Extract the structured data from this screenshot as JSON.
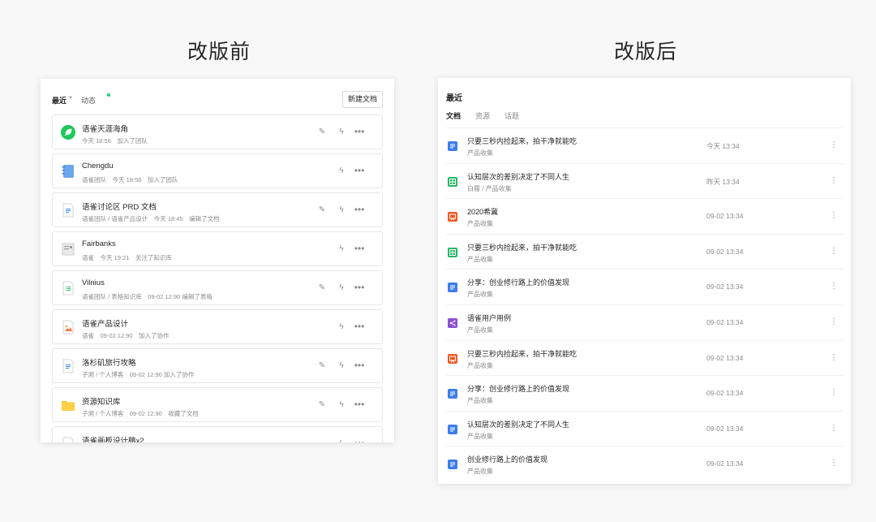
{
  "titles": {
    "before": "改版前",
    "after": "改版后"
  },
  "before": {
    "tab_recent": "最近",
    "tab_activity": "动态",
    "new_button": "新建文档",
    "cards": [
      {
        "icon": "green-leaf-icon",
        "title": "语雀天涯海角",
        "meta": "今天 18:56　加入了团队",
        "has_edit": true
      },
      {
        "icon": "blue-notebook-icon",
        "title": "Chengdu",
        "meta": "语雀团队　今天 18:58　加入了团队",
        "has_edit": false
      },
      {
        "icon": "doc-icon",
        "title": "语雀讨论区 PRD 文档",
        "meta": "语雀团队 / 语雀产品设计　今天 18:45　编辑了文档",
        "has_edit": true
      },
      {
        "icon": "book-icon",
        "title": "Fairbanks",
        "meta": "语雀　今天 19:21　关注了知识库",
        "has_edit": false
      },
      {
        "icon": "sheet-icon",
        "title": "Vilnius",
        "meta": "语雀团队 / 表格知识库　09-02 12:90 编辑了表格",
        "has_edit": true
      },
      {
        "icon": "image-icon",
        "title": "语雀产品设计",
        "meta": "语雀　09-02 12:90　加入了协作",
        "has_edit": false
      },
      {
        "icon": "doc-icon",
        "title": "洛杉矶旅行攻略",
        "meta": "子溯 / 个人博客　09-02 12:90 加入了协作",
        "has_edit": true
      },
      {
        "icon": "folder-icon",
        "title": "资源知识库",
        "meta": "子溯 / 个人博客　09-02 12:90　收藏了文档",
        "has_edit": true
      },
      {
        "icon": "board-icon",
        "title": "语雀画板设计稿x2",
        "meta": "",
        "has_edit": false
      }
    ]
  },
  "after": {
    "heading": "最近",
    "tabs": [
      "文档",
      "资源",
      "话题"
    ],
    "rows": [
      {
        "icon": "doc-blue-icon",
        "color": "#3d7de8",
        "title": "只要三秒内捡起来，拍干净就能吃",
        "sub": "产品收集",
        "time": "今天 13:34"
      },
      {
        "icon": "sheet-green-icon",
        "color": "#25b864",
        "title": "认知层次的差别决定了不同人生",
        "sub": "白履 / 产品收集",
        "time": "昨天 13:34"
      },
      {
        "icon": "slides-orange-icon",
        "color": "#ee5a24",
        "title": "2020希冀",
        "sub": "产品收集",
        "time": "09-02 13:34"
      },
      {
        "icon": "sheet-green-icon",
        "color": "#25b864",
        "title": "只要三秒内捡起来，拍干净就能吃",
        "sub": "产品收集",
        "time": "09-02 13:34"
      },
      {
        "icon": "doc-blue-icon",
        "color": "#3d7de8",
        "title": "分享：创业修行路上的价值发现",
        "sub": "产品收集",
        "time": "09-02 13:34"
      },
      {
        "icon": "mindmap-purple-icon",
        "color": "#8a4fd6",
        "title": "语雀用户用例",
        "sub": "产品收集",
        "time": "09-02 13:34"
      },
      {
        "icon": "slides-orange-icon",
        "color": "#ee5a24",
        "title": "只要三秒内捡起来，拍干净就能吃",
        "sub": "产品收集",
        "time": "09-02 13:34"
      },
      {
        "icon": "doc-blue-icon",
        "color": "#3d7de8",
        "title": "分享：创业修行路上的价值发现",
        "sub": "产品收集",
        "time": "09-02 13:34"
      },
      {
        "icon": "doc-blue-icon",
        "color": "#3d7de8",
        "title": "认知层次的差别决定了不同人生",
        "sub": "产品收集",
        "time": "09-02 13:34"
      },
      {
        "icon": "doc-blue-icon",
        "color": "#3d7de8",
        "title": "创业修行路上的价值发现",
        "sub": "产品收集",
        "time": "09-02 13:34"
      }
    ]
  }
}
